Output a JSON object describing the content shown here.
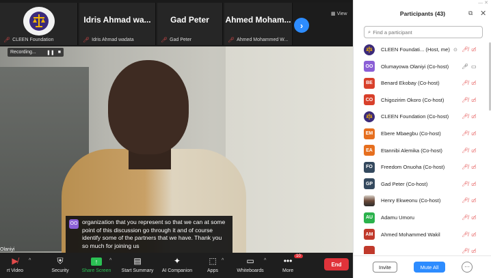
{
  "top_strip": {
    "view_label": "View",
    "tiles": [
      {
        "big": "",
        "name": "CLEEN Foundation",
        "logo": true
      },
      {
        "big": "Idris Ahmad wa...",
        "name": "Idris Ahmad wadata"
      },
      {
        "big": "Gad Peter",
        "name": "Gad Peter"
      },
      {
        "big": "Ahmed Moham...",
        "name": "Ahmed Mohammed W..."
      }
    ],
    "next_icon": "chevron-right-icon"
  },
  "recording": {
    "label": "Recording...",
    "pause_icon": "pause-icon",
    "stop_icon": "stop-icon"
  },
  "active_speaker_name": "Olaniyi",
  "caption": {
    "badge": "OO",
    "text": "organization that you represent so that we can at some point of this discussion go through it and of course identify some of the partners that we have. Thank you so much for joining us"
  },
  "toolbar": {
    "items": [
      {
        "label": "rt Video",
        "icon": "video-off-icon"
      },
      {
        "label": "Security",
        "icon": "shield-icon"
      },
      {
        "label": "Share Screen",
        "icon": "share-screen-icon"
      },
      {
        "label": "Start Summary",
        "icon": "summary-icon"
      },
      {
        "label": "AI Companion",
        "icon": "sparkle-icon"
      },
      {
        "label": "Apps",
        "icon": "apps-icon"
      },
      {
        "label": "Whiteboards",
        "icon": "whiteboard-icon"
      },
      {
        "label": "More",
        "icon": "more-icon"
      }
    ],
    "more_badge": "10",
    "end_label": "End"
  },
  "panel": {
    "title": "Participants (43)",
    "search_placeholder": "Find a participant",
    "participants": [
      {
        "initials": "",
        "name": "CLEEN Foundati... (Host, me)",
        "color": "#3b2a7a",
        "logo": true,
        "mic": "muted",
        "cam": "off",
        "extra": "⊙"
      },
      {
        "initials": "OO",
        "name": "Olumayowa Olaniyi (Co-host)",
        "color": "#8b5fd6",
        "mic": "on",
        "cam": "on"
      },
      {
        "initials": "BE",
        "name": "Benard Ekobay (Co-host)",
        "color": "#d8402b",
        "mic": "muted",
        "cam": "off"
      },
      {
        "initials": "CO",
        "name": "Chigozirim Okoro (Co-host)",
        "color": "#d8402b",
        "mic": "muted",
        "cam": "off"
      },
      {
        "initials": "",
        "name": "CLEEN Foundation (Co-host)",
        "color": "#3b2a7a",
        "logo": true,
        "mic": "muted",
        "cam": "off"
      },
      {
        "initials": "EM",
        "name": "Ebere Mbaegbu (Co-host)",
        "color": "#e66f1f",
        "mic": "muted",
        "cam": "off"
      },
      {
        "initials": "EA",
        "name": "Etannibi Alemika (Co-host)",
        "color": "#e66f1f",
        "mic": "muted",
        "cam": "off"
      },
      {
        "initials": "FO",
        "name": "Freedom Onuoha (Co-host)",
        "color": "#34495e",
        "mic": "muted",
        "cam": "off"
      },
      {
        "initials": "GP",
        "name": "Gad Peter (Co-host)",
        "color": "#34495e",
        "mic": "muted",
        "cam": "off"
      },
      {
        "initials": "",
        "name": "Henry Ekweonu (Co-host)",
        "color": "#6b4a3a",
        "photo": true,
        "mic": "muted",
        "cam": "off"
      },
      {
        "initials": "AU",
        "name": "Adamu Umoru",
        "color": "#2bb24c",
        "mic": "muted",
        "cam": "off"
      },
      {
        "initials": "AM",
        "name": "Ahmed Mohammed Wakil",
        "color": "#c0392b",
        "mic": "muted",
        "cam": "off"
      },
      {
        "initials": "",
        "name": "",
        "color": "#c0392b",
        "mic": "muted",
        "cam": "off"
      }
    ],
    "invite_label": "Invite",
    "mute_all_label": "Mute All",
    "more_label": "···"
  }
}
